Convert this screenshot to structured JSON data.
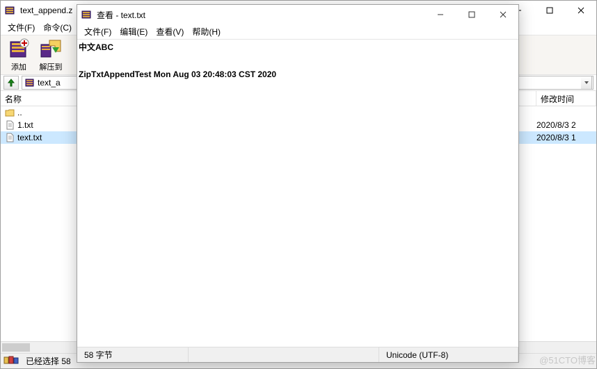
{
  "main": {
    "title": "text_append.z",
    "menus": [
      "文件(F)",
      "命令(C)"
    ],
    "toolbar": {
      "add": "添加",
      "extract": "解压到"
    },
    "path_label": "text_a",
    "columns": {
      "name": "名称",
      "mtime": "修改时间"
    },
    "rows": [
      {
        "name": "..",
        "date": "",
        "type": "up"
      },
      {
        "name": "1.txt",
        "date": "2020/8/3 2",
        "type": "txt"
      },
      {
        "name": "text.txt",
        "date": "2020/8/3 1",
        "type": "txt",
        "selected": true
      }
    ],
    "status_sel": "已经选择 58",
    "win_min": "–",
    "win_max": "▢",
    "win_close": "✕"
  },
  "viewer": {
    "title": "查看 - text.txt",
    "menus": [
      "文件(F)",
      "编辑(E)",
      "查看(V)",
      "帮助(H)"
    ],
    "content_l1": "中文ABC",
    "content_l2": "",
    "content_l3": "ZipTxtAppendTest Mon Aug 03 20:48:03 CST 2020",
    "status_bytes": "58 字节",
    "status_enc": "Unicode (UTF-8)"
  },
  "watermark": "@51CTO博客"
}
